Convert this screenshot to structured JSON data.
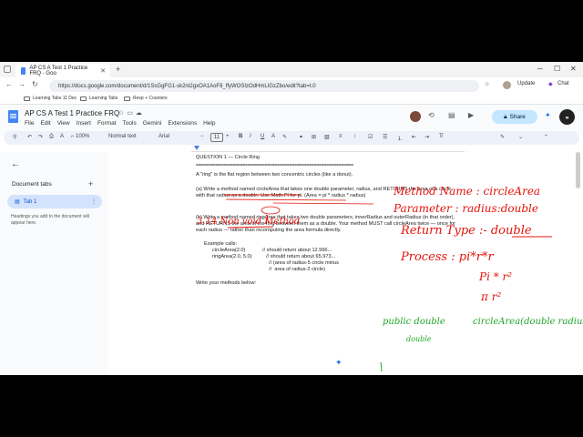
{
  "browser": {
    "tab_title": "AP CS A Test 1 Practice FRQ - Goo",
    "url": "https://docs.google.com/document/d/1SsGgFG1-sk2nt2gxOA1AoF8_ffyWOSIzOdHmLIGzZbo/edit?tab=t.0",
    "update_label": "Update",
    "chat_label": "Chat",
    "bookmarks": [
      "Learning Tabs 11 Dec",
      "Learning Tabs",
      "Resp + Counters"
    ]
  },
  "doc": {
    "title": "AP CS A Test 1 Practice FRQ",
    "menu": [
      "File",
      "Edit",
      "View",
      "Insert",
      "Format",
      "Tools",
      "Gemini",
      "Extensions",
      "Help"
    ],
    "share_label": "Share",
    "toolbar": {
      "zoom": "100%",
      "style": "Normal text",
      "font": "Arial",
      "size": "11"
    }
  },
  "sidebar": {
    "title": "Document tabs",
    "tab_label": "Tab 1",
    "help_text": "Headings you add to the document will appear here."
  },
  "content": {
    "heading": "QUESTION 1 — Circle Ring",
    "divider": "================================================================",
    "intro": "A \"ring\" is the flat region between two concentric circles (like a donut).",
    "part_a": "(a) Write a method named circleArea that takes one double parameter, radius, and RETURNS the area of a circle with that radius as a double. Use Math.PI for pi. (Area = pi * radius * radius)",
    "part_b": "(b) Write a method named ringArea that takes two double parameters, innerRadius and outerRadius (in that order), and RETURNS the area of the ring between them as a double. Your method MUST call circleArea twice — once for each radius — rather than recomputing the area formula directly.",
    "example_label": "Example calls:",
    "ex1": "circleArea(2.0)            // should return about 12.566...",
    "ex2": "ringArea(2.0, 5.0)          // should return about 65.973...",
    "ex3": "                                        // (area of radius-5 circle minus",
    "ex4": "                                        //  area of radius-2 circle)",
    "write_prompt": "Write your methods below:"
  },
  "annotations": {
    "method_name": "Method Name : circleArea",
    "parameter": "Parameter : radius:double",
    "return_type": "Return Type :- double",
    "process": "Process :  pi*r*r",
    "process2": "Pi * r²",
    "process3": "π r²",
    "signature_public": "public double",
    "signature_method": "circleArea(double radius){",
    "signature_next": "double",
    "under_a": "3.14   Non void Method",
    "ink_red": "#e5140c",
    "ink_green": "#22a62a"
  }
}
